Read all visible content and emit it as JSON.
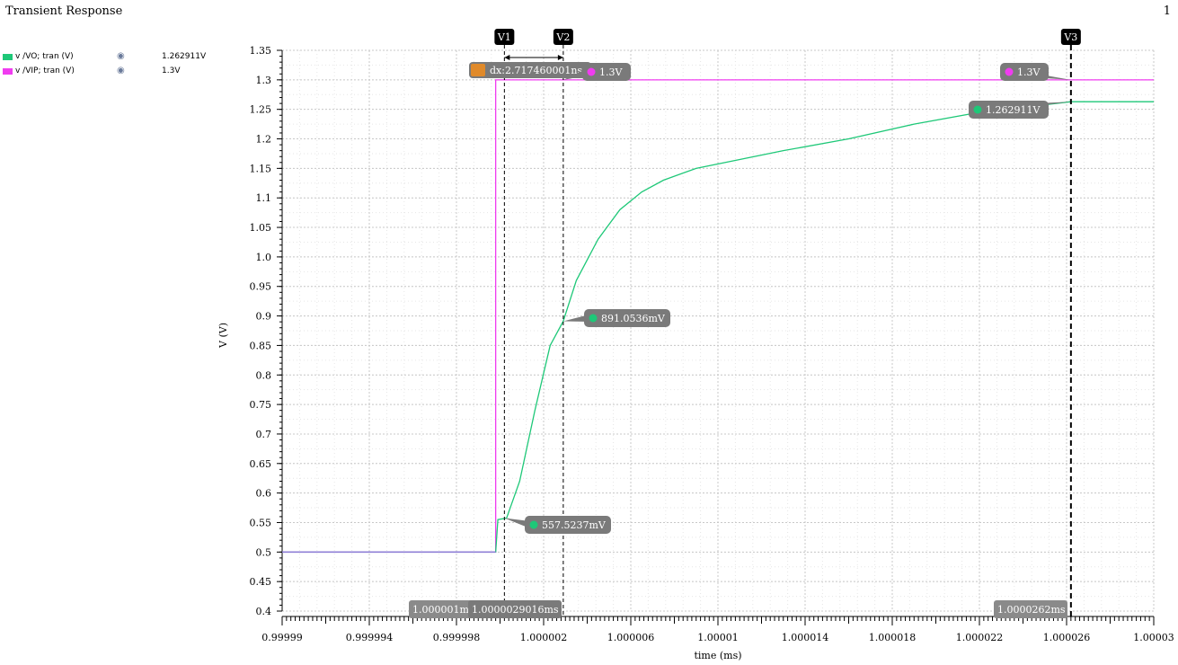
{
  "window": {
    "title": "Transient Response",
    "page_number": "1"
  },
  "legend": [
    {
      "name": "v /VO; tran (V)",
      "value": "1.262911V",
      "color": "#1ec878",
      "icon": "eye-icon"
    },
    {
      "name": "v /VIP; tran (V)",
      "value": "1.3V",
      "color": "#f03cf0",
      "icon": "eye-icon"
    }
  ],
  "chart_data": {
    "type": "line",
    "xlabel": "time (ms)",
    "ylabel": "V (V)",
    "xlim": [
      0.99999,
      1.00003
    ],
    "ylim": [
      0.4,
      1.35
    ],
    "x_ticks": [
      "0.99999",
      "0.999994",
      "0.999998",
      "1.000002",
      "1.000006",
      "1.00001",
      "1.000014",
      "1.000018",
      "1.000022",
      "1.000026",
      "1.00003"
    ],
    "y_ticks": [
      "0.4",
      "0.45",
      "0.5",
      "0.55",
      "0.6",
      "0.65",
      "0.7",
      "0.75",
      "0.8",
      "0.85",
      "0.9",
      "0.95",
      "1.0",
      "1.05",
      "1.1",
      "1.15",
      "1.2",
      "1.25",
      "1.3",
      "1.35"
    ],
    "grid": true,
    "series": [
      {
        "name": "v /VIP; tran (V)",
        "color": "#f03cf0",
        "points": [
          [
            0.99999,
            0.5
          ],
          [
            0.9999998,
            0.5
          ],
          [
            0.9999998,
            1.3
          ],
          [
            1.00003,
            1.3
          ]
        ]
      },
      {
        "name": "v /VO; tran (V)",
        "color": "#1ec878",
        "points": [
          [
            0.99999,
            0.5
          ],
          [
            0.9999998,
            0.5
          ],
          [
            0.9999999,
            0.555
          ],
          [
            1.0000003,
            0.5575
          ],
          [
            1.0000009,
            0.62
          ],
          [
            1.0000016,
            0.74
          ],
          [
            1.0000023,
            0.85
          ],
          [
            1.0000029,
            0.891
          ],
          [
            1.0000035,
            0.96
          ],
          [
            1.0000045,
            1.03
          ],
          [
            1.0000055,
            1.08
          ],
          [
            1.0000065,
            1.11
          ],
          [
            1.0000075,
            1.13
          ],
          [
            1.000009,
            1.15
          ],
          [
            1.000011,
            1.165
          ],
          [
            1.000013,
            1.18
          ],
          [
            1.000016,
            1.2
          ],
          [
            1.000019,
            1.225
          ],
          [
            1.000022,
            1.245
          ],
          [
            1.0000262,
            1.2629
          ],
          [
            1.00003,
            1.2629
          ]
        ]
      }
    ],
    "markers": [
      {
        "label": "V1",
        "x": 1.0000002
      },
      {
        "label": "V2",
        "x": 1.0000029016
      },
      {
        "label": "V3",
        "x": 1.0000262
      }
    ],
    "delta_label": "dx:2.717460001ns",
    "annotations": [
      {
        "text": "1.3V",
        "x": 1.0000029016,
        "y": 1.3,
        "color": "#f03cf0"
      },
      {
        "text": "1.3V",
        "x": 1.0000262,
        "y": 1.3,
        "color": "#f03cf0"
      },
      {
        "text": "1.262911V",
        "x": 1.0000262,
        "y": 1.262911,
        "color": "#1ec878"
      },
      {
        "text": "891.0536mV",
        "x": 1.0000029016,
        "y": 0.8910536,
        "color": "#1ec878"
      },
      {
        "text": "557.5237mV",
        "x": 1.0000002,
        "y": 0.5575237,
        "color": "#1ec878"
      }
    ],
    "x_readouts": [
      "1.000001ms",
      "1.0000029016ms",
      "1.0000262ms"
    ]
  }
}
